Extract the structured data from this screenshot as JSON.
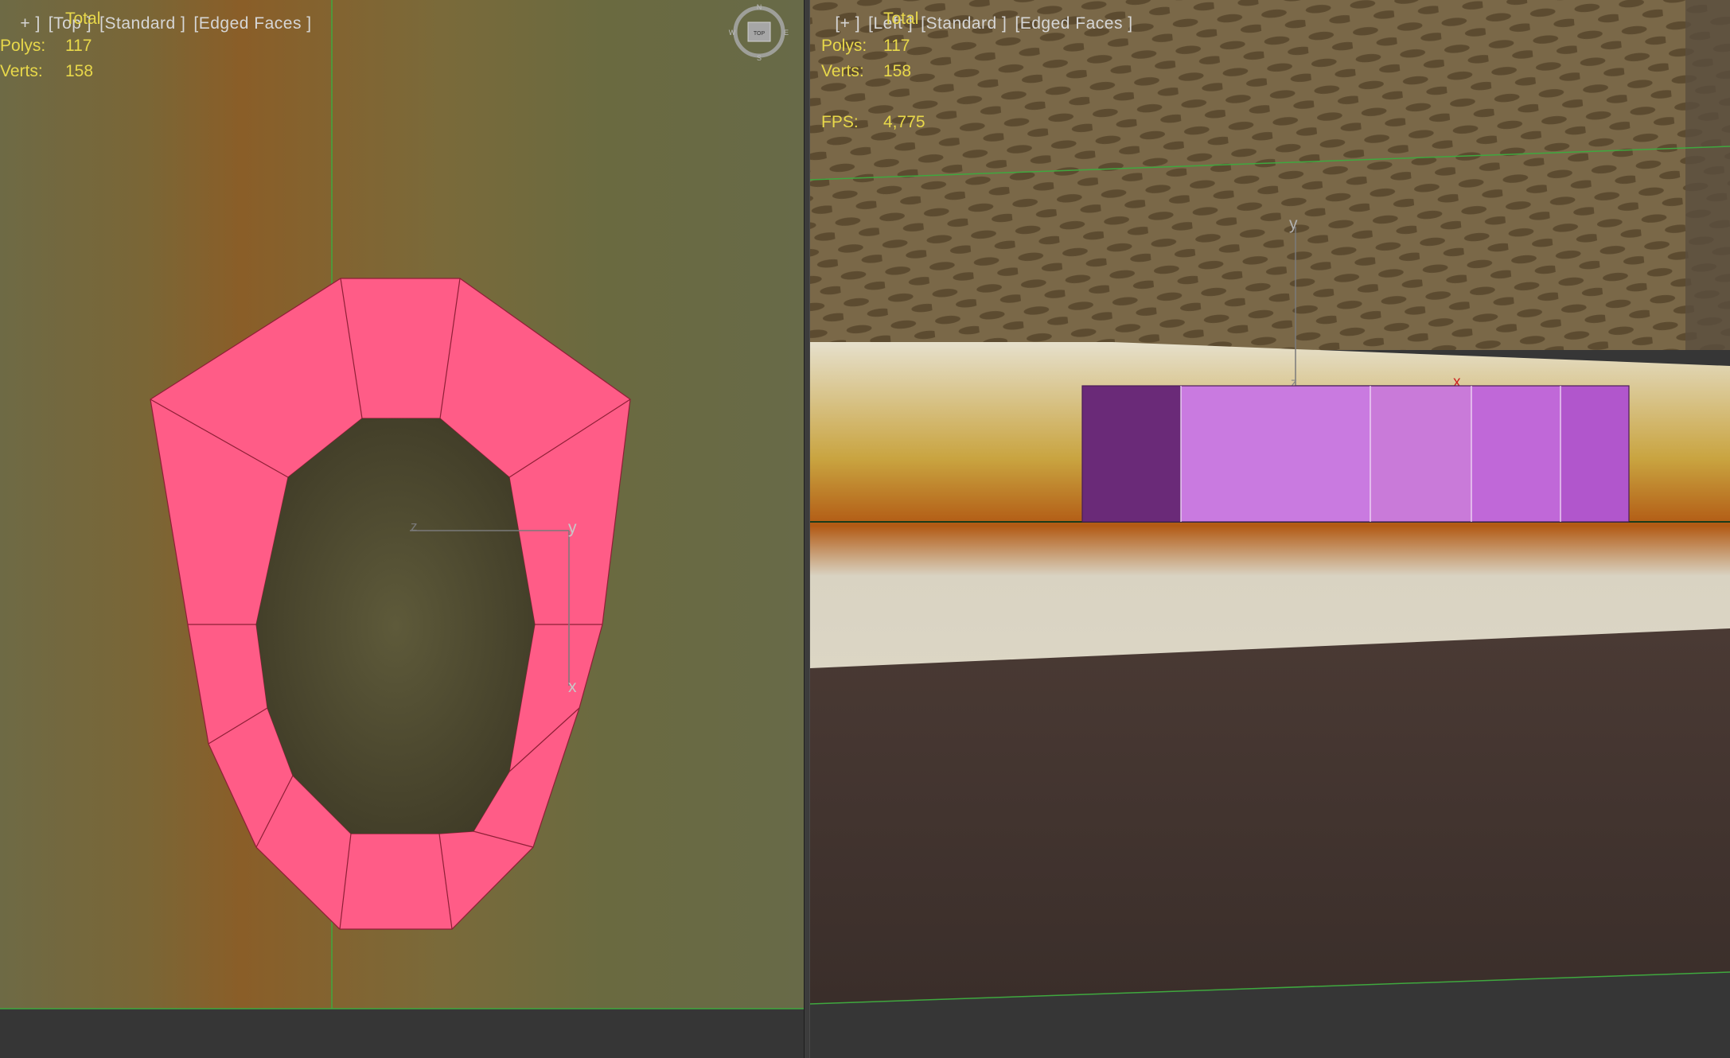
{
  "viewport_top": {
    "labels": [
      "+ ]",
      "[Top ]",
      "[Standard ]",
      "[Edged Faces ]"
    ],
    "stats": {
      "header": "Total",
      "polys_label": "Polys:",
      "polys_value": "117",
      "verts_label": "Verts:",
      "verts_value": "158"
    },
    "gizmo_axes": {
      "a": "z",
      "b": "y",
      "c": "x"
    },
    "viewcube": {
      "center": "TOP",
      "n": "N",
      "s": "S",
      "e": "E",
      "w": "W"
    }
  },
  "viewport_left": {
    "labels": [
      "[+ ]",
      "[Left ]",
      "[Standard ]",
      "[Edged Faces ]"
    ],
    "stats": {
      "header": "Total",
      "polys_label": "Polys:",
      "polys_value": "117",
      "verts_label": "Verts:",
      "verts_value": "158",
      "fps_label": "FPS:",
      "fps_value": "4,775"
    },
    "gizmo_axes": {
      "a": "y",
      "b": "z",
      "c": "x"
    }
  },
  "colors": {
    "mesh_pink": "#ff5c87",
    "mesh_edge": "#8e1f36",
    "stats_yellow": "#e8d84a",
    "grid_green": "#3fa83f",
    "side_dark": "#6a2a78",
    "side_light": "#c97ae0",
    "side_mid": "#b156cc"
  }
}
